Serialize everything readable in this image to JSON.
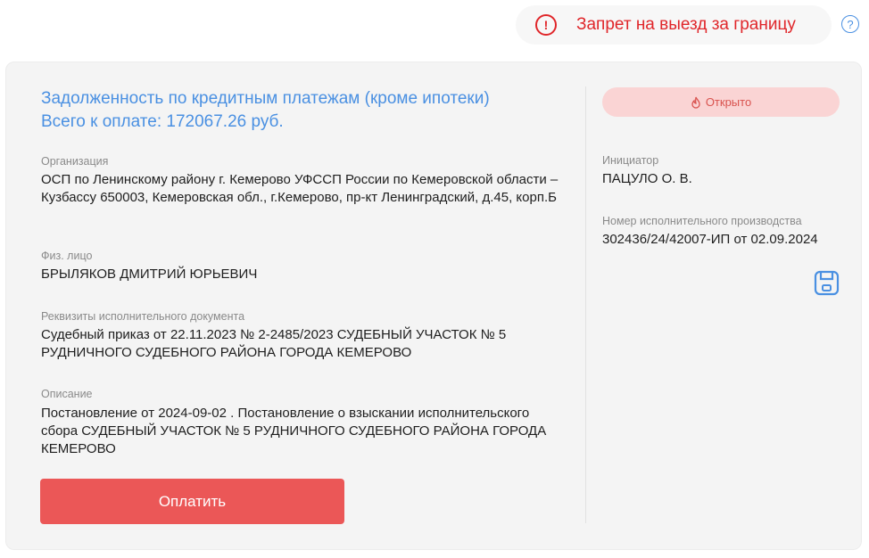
{
  "top": {
    "warning_text": "Запрет на выезд за границу",
    "warning_icon": "exclamation-circle-icon",
    "help_icon": "?"
  },
  "debt": {
    "title_line1": "Задолженность по кредитным платежам (кроме ипотеки)",
    "title_line2": "Всего к оплате: 172067.26 руб.",
    "org_label": "Организация",
    "org_value": "ОСП по Ленинскому району г. Кемерово УФССП России по Кемеровской области – Кузбассу 650003, Кемеровская обл., г.Кемерово, пр-кт Ленинградский, д.45, корп.Б",
    "person_label": "Физ. лицо",
    "person_value": "БРЫЛЯКОВ ДМИТРИЙ ЮРЬЕВИЧ",
    "doc_label": "Реквизиты исполнительного документа",
    "doc_value": "Судебный приказ от 22.11.2023 № 2-2485/2023 СУДЕБНЫЙ УЧАСТОК № 5 РУДНИЧНОГО СУДЕБНОГО РАЙОНА ГОРОДА КЕМЕРОВО",
    "desc_label": "Описание",
    "desc_value": "Постановление от 2024-09-02 . Постановление о взыскании исполнительского сбора СУДЕБНЫЙ УЧАСТОК № 5 РУДНИЧНОГО СУДЕБНОГО РАЙОНА ГОРОДА КЕМЕРОВО",
    "pay_button": "Оплатить"
  },
  "side": {
    "status": "Открыто",
    "status_icon": "flame-icon",
    "initiator_label": "Инициатор",
    "initiator_value": "ПАЦУЛО О. В.",
    "case_label": "Номер исполнительного производства",
    "case_value": "302436/24/42007-ИП от 02.09.2024",
    "save_icon": "save-icon"
  },
  "colors": {
    "accent_blue": "#4a90e2",
    "danger_red": "#e0262a",
    "button_red": "#eb5757",
    "badge_bg": "#fad4d4"
  }
}
